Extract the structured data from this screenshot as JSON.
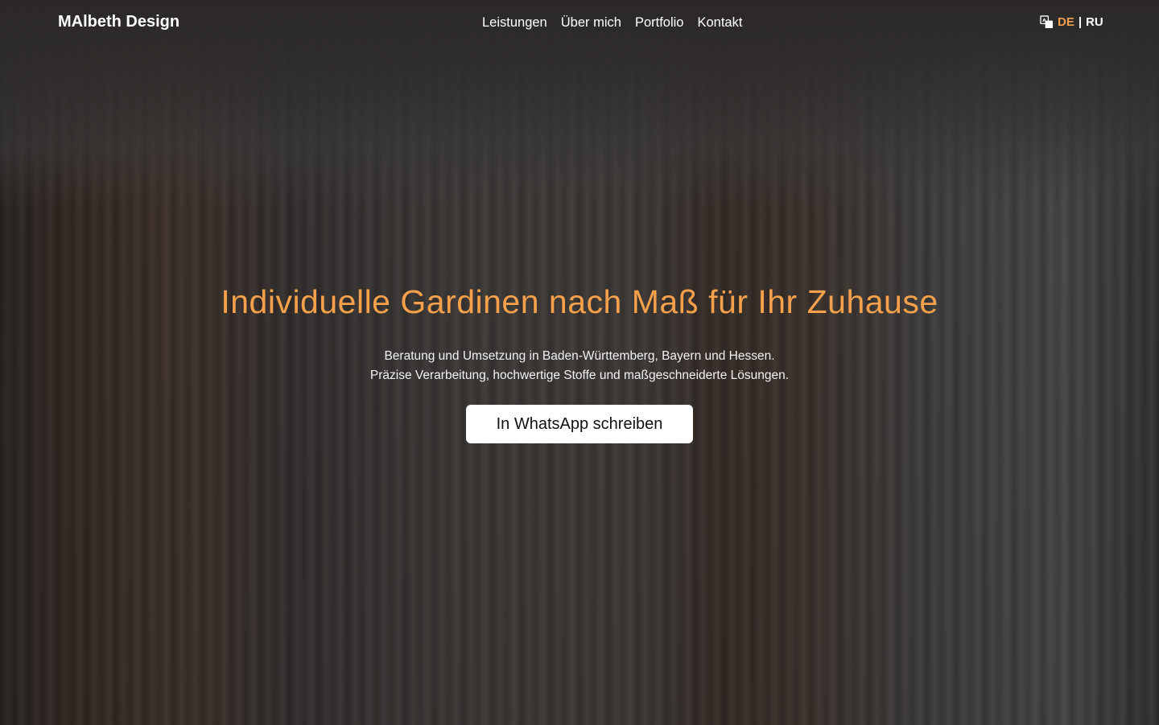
{
  "header": {
    "logo": "MAlbeth Design",
    "nav": [
      "Leistungen",
      "Über mich",
      "Portfolio",
      "Kontakt"
    ],
    "language": {
      "icon": "translate-icon",
      "active": "DE",
      "separator": "|",
      "other": "RU",
      "active_color": "#f0a050"
    }
  },
  "hero": {
    "title": "Individuelle Gardinen nach Maß für Ihr Zuhause",
    "title_color": "#f5a04a",
    "subtitle_line1": "Beratung und Umsetzung in Baden-Württemberg, Bayern und Hessen.",
    "subtitle_line2": "Präzise Verarbeitung, hochwertige Stoffe und maßgeschneiderte Lösungen.",
    "cta": "In WhatsApp schreiben"
  }
}
